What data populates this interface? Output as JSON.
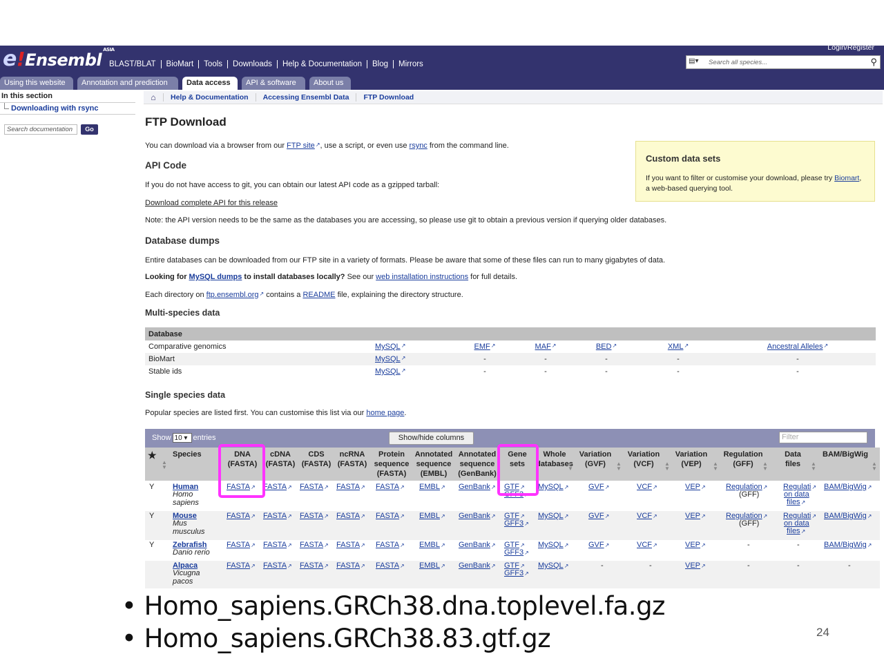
{
  "header": {
    "logo_text": "Ensembl",
    "logo_suffix": "ASIA",
    "nav": [
      "BLAST/BLAT",
      "BioMart",
      "Tools",
      "Downloads",
      "Help & Documentation",
      "Blog",
      "Mirrors"
    ],
    "login": "Login/Register",
    "search_placeholder": "Search all species..."
  },
  "tabs": [
    "Using this website",
    "Annotation and prediction",
    "Data access",
    "API & software",
    "About us"
  ],
  "sidebar": {
    "title": "In this section",
    "item": "Downloading with rsync",
    "search_placeholder": "Search documentation",
    "go": "Go"
  },
  "breadcrumb": [
    "Help & Documentation",
    "Accessing Ensembl Data",
    "FTP Download"
  ],
  "page": {
    "title": "FTP Download",
    "intro_1": "You can download via a browser from our ",
    "intro_ftp": "FTP site",
    "intro_2": ", use a script, or even use ",
    "intro_rsync": "rsync",
    "intro_3": " from the command line.",
    "api_heading": "API Code",
    "api_text": "If you do not have access to git, you can obtain our latest API code as a gzipped tarball:",
    "api_link": "Download complete API for this release",
    "api_note": "Note: the API version needs to be the same as the databases you are accessing, so please use git to obtain a previous version if querying older databases.",
    "dumps_heading": "Database dumps",
    "dumps_text": "Entire databases can be downloaded from our FTP site in a variety of formats. Please be aware that some of these files can run to many gigabytes of data.",
    "looking_1": "Looking for ",
    "looking_link": "MySQL dumps",
    "looking_2": " to install databases locally?",
    "looking_3": " See our ",
    "looking_link2": "web installation instructions",
    "looking_4": " for full details.",
    "each_1": "Each directory on ",
    "each_link": "ftp.ensembl.org",
    "each_2": " contains a ",
    "each_link2": "README",
    "each_3": " file, explaining the directory structure.",
    "multi_heading": "Multi-species data",
    "single_heading": "Single species data",
    "single_text_1": "Popular species are listed first. You can customise this list via our ",
    "single_link": "home page",
    "single_text_2": "."
  },
  "custom_box": {
    "title": "Custom data sets",
    "text_1": "If you want to filter or customise your download, please try ",
    "link": "Biomart",
    "text_2": ", a web-based querying tool."
  },
  "multi_table": {
    "header": "Database",
    "rows": [
      {
        "name": "Comparative genomics",
        "cells": [
          "MySQL",
          "EMF",
          "MAF",
          "BED",
          "XML",
          "Ancestral Alleles"
        ]
      },
      {
        "name": "BioMart",
        "cells": [
          "MySQL",
          "-",
          "-",
          "-",
          "-",
          "-"
        ]
      },
      {
        "name": "Stable ids",
        "cells": [
          "MySQL",
          "-",
          "-",
          "-",
          "-",
          "-"
        ]
      }
    ]
  },
  "single_table": {
    "show": "Show",
    "entries_value": "10",
    "entries": "entries",
    "show_hide": "Show/hide columns",
    "filter_placeholder": "Filter",
    "star": "★",
    "headers": [
      [
        "Species"
      ],
      [
        "DNA",
        "(FASTA)"
      ],
      [
        "cDNA",
        "(FASTA)"
      ],
      [
        "CDS",
        "(FASTA)"
      ],
      [
        "ncRNA",
        "(FASTA)"
      ],
      [
        "Protein",
        "sequence",
        "(FASTA)"
      ],
      [
        "Annotated",
        "sequence",
        "(EMBL)"
      ],
      [
        "Annotated",
        "sequence",
        "(GenBank)"
      ],
      [
        "Gene",
        "sets"
      ],
      [
        "Whole",
        "databases"
      ],
      [
        "Variation",
        "(GVF)"
      ],
      [
        "Variation",
        "(VCF)"
      ],
      [
        "Variation",
        "(VEP)"
      ],
      [
        "Regulation",
        "(GFF)"
      ],
      [
        "Data",
        "files"
      ],
      [
        "BAM/BigWig"
      ]
    ],
    "rows": [
      {
        "fav": "Y",
        "common": "Human",
        "sci": [
          "Homo",
          "sapiens"
        ],
        "cells": [
          "FASTA",
          "FASTA",
          "FASTA",
          "FASTA",
          "FASTA",
          "EMBL",
          "GenBank",
          "GTF",
          "MySQL",
          "GVF",
          "VCF",
          "VEP",
          "Regulation",
          "Regulati",
          "BAM/BigWig"
        ],
        "extra": {
          "genesets2": "GFF3",
          "reg2": "(GFF)",
          "data2": "on data",
          "data3": "files"
        }
      },
      {
        "fav": "Y",
        "common": "Mouse",
        "sci": [
          "Mus",
          "musculus"
        ],
        "cells": [
          "FASTA",
          "FASTA",
          "FASTA",
          "FASTA",
          "FASTA",
          "EMBL",
          "GenBank",
          "GTF",
          "MySQL",
          "GVF",
          "VCF",
          "VEP",
          "Regulation",
          "Regulati",
          "BAM/BigWig"
        ],
        "extra": {
          "genesets2": "GFF3",
          "reg2": "(GFF)",
          "data2": "on data",
          "data3": "files"
        }
      },
      {
        "fav": "Y",
        "common": "Zebrafish",
        "sci": [
          "Danio rerio"
        ],
        "cells": [
          "FASTA",
          "FASTA",
          "FASTA",
          "FASTA",
          "FASTA",
          "EMBL",
          "GenBank",
          "GTF",
          "MySQL",
          "GVF",
          "VCF",
          "VEP",
          "-",
          "-",
          "BAM/BigWig"
        ],
        "extra": {
          "genesets2": "GFF3"
        }
      },
      {
        "fav": "",
        "common": "Alpaca",
        "sci": [
          "Vicugna",
          "pacos"
        ],
        "cells": [
          "FASTA",
          "FASTA",
          "FASTA",
          "FASTA",
          "FASTA",
          "EMBL",
          "GenBank",
          "GTF",
          "MySQL",
          "-",
          "-",
          "VEP",
          "-",
          "-",
          "-"
        ],
        "extra": {
          "genesets2": "GFF3"
        }
      }
    ]
  },
  "bullets": [
    "Homo_sapiens.GRCh38.dna.toplevel.fa.gz",
    "Homo_sapiens.GRCh38.83.gtf.gz"
  ],
  "bullet_char": "•",
  "page_number": "24",
  "colors": {
    "masthead": "#33336e",
    "highlight": "#ff33ff",
    "link": "#1a3d9c",
    "note_box": "#fdfbd0"
  },
  "icons": {
    "home": "home-icon",
    "search": "search-icon",
    "external": "external-link-icon"
  }
}
